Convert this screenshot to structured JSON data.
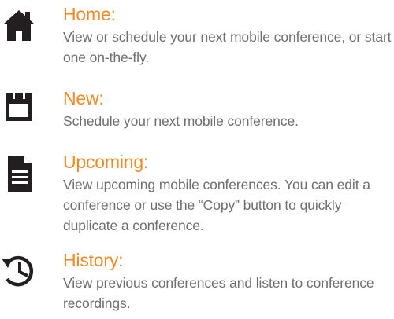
{
  "colors": {
    "title": "#f08a24",
    "description": "#6d6e71",
    "icon": "#231f20"
  },
  "items": [
    {
      "icon": "home-icon",
      "title": "Home:",
      "description": "View or schedule your next mobile conference, or start one on-the-fly."
    },
    {
      "icon": "calendar-icon",
      "title": "New:",
      "description": "Schedule your next mobile conference."
    },
    {
      "icon": "document-icon",
      "title": "Upcoming:",
      "description": "View upcoming mobile conferences. You can edit a conference or use the “Copy” button to quickly duplicate a conference."
    },
    {
      "icon": "history-icon",
      "title": "History:",
      "description": "View previous conferences and listen to conference recordings."
    }
  ]
}
